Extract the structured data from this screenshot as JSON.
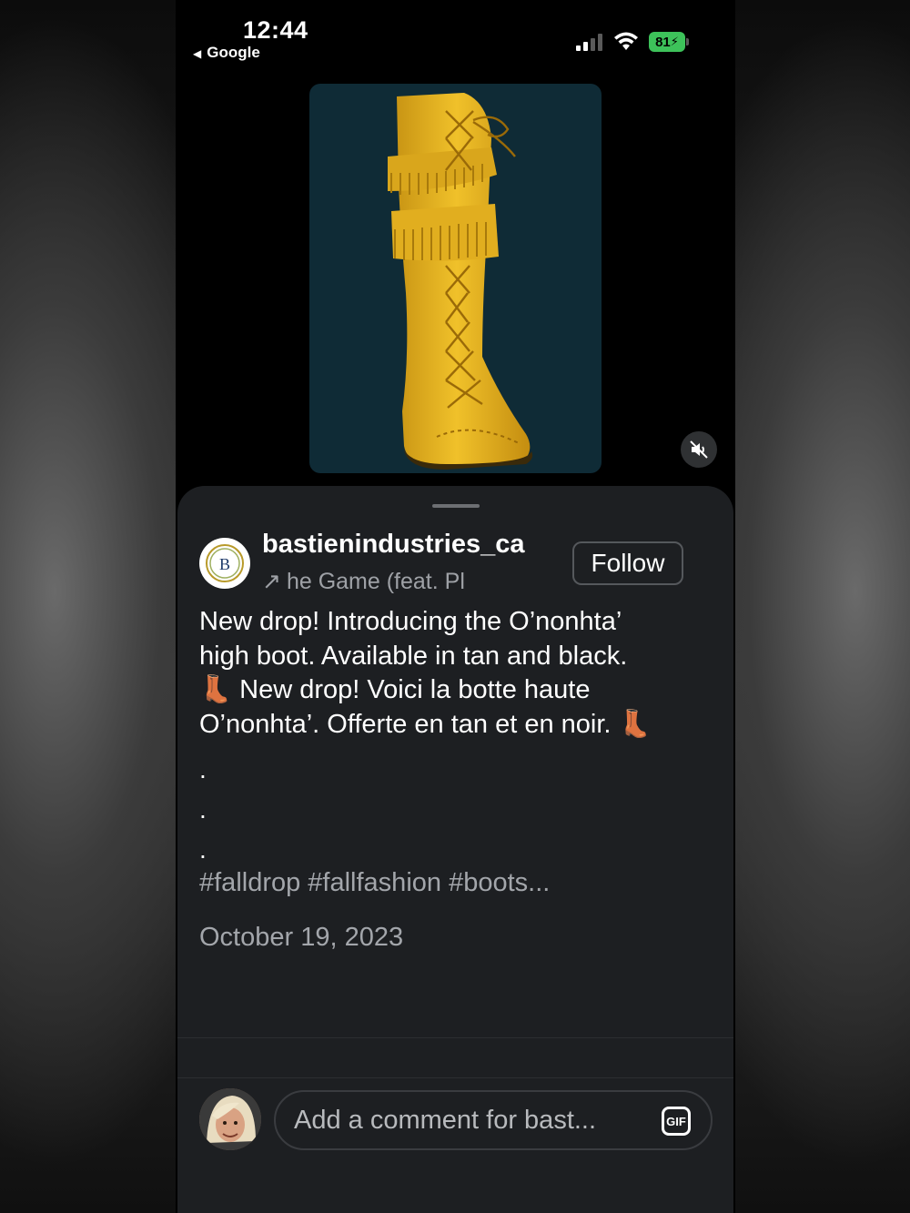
{
  "status_bar": {
    "time": "12:44",
    "back_app": "Google",
    "battery": "81"
  },
  "post": {
    "username": "bastienindustries_ca",
    "audio": "he Game (feat. Pl",
    "follow_label": "Follow",
    "caption_lines": [
      "New drop! Introducing the O’nonhta’",
      "high boot. Available in tan and black.",
      "👢 New drop! Voici la botte haute",
      "O’nonhta’. Offerte en tan et en noir. 👢"
    ],
    "dots": [
      ".",
      ".",
      "."
    ],
    "hashtags": "#falldrop #fallfashion #boots...",
    "date": "October 19, 2023"
  },
  "comment": {
    "placeholder": "Add a comment for bast...",
    "gif_label": "GIF"
  },
  "colors": {
    "sheet_bg": "#1d1f22",
    "media_bg": "#0f2b36",
    "boot": "#e5b41f",
    "battery": "#3dc25a"
  },
  "icons": {
    "mute": "speaker-muted-icon",
    "gif": "gif-icon"
  }
}
